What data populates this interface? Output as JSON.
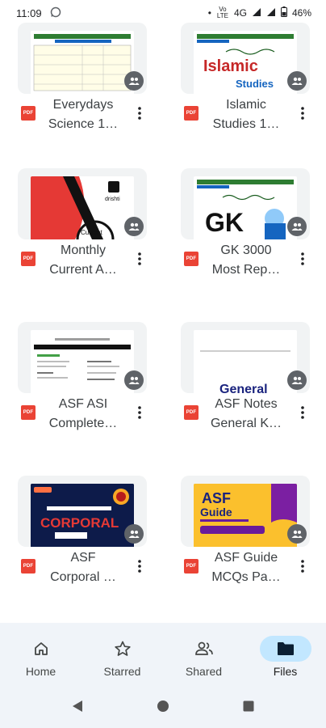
{
  "status_bar": {
    "time": "11:09",
    "network": "4G",
    "volte": "Vo LTE",
    "battery": "46%"
  },
  "files": [
    {
      "name": "Everydays\nScience 1…",
      "thumb_label": "",
      "thumb_theme": "table"
    },
    {
      "name": "Islamic\nStudies 1…",
      "thumb_label": "Islamic\nStudies",
      "thumb_theme": "islamic"
    },
    {
      "name": "Monthly\nCurrent A…",
      "thumb_label": "drishti",
      "thumb_theme": "drishti"
    },
    {
      "name": "GK 3000\nMost Rep…",
      "thumb_label": "GK",
      "thumb_theme": "gk"
    },
    {
      "name": "ASF ASI\nComplete…",
      "thumb_label": "Airport Security Force(ASF)",
      "thumb_theme": "asfasi"
    },
    {
      "name": "ASF Notes\nGeneral K…",
      "thumb_label": "General",
      "thumb_theme": "general"
    },
    {
      "name": "ASF\nCorporal …",
      "thumb_label": "CORPORAL",
      "thumb_theme": "corporal"
    },
    {
      "name": "ASF Guide\nMCQs Pa…",
      "thumb_label": "ASF\nGuide",
      "thumb_theme": "guide"
    }
  ],
  "file_type_badge": "PDF",
  "bottom_nav": [
    {
      "label": "Home",
      "icon": "home-icon",
      "active": false
    },
    {
      "label": "Starred",
      "icon": "star-icon",
      "active": false
    },
    {
      "label": "Shared",
      "icon": "shared-icon",
      "active": false
    },
    {
      "label": "Files",
      "icon": "folder-icon",
      "active": true
    }
  ],
  "colors": {
    "pdf_red": "#ea4335",
    "nav_background": "#f0f4f9",
    "active_pill": "#c2e7ff",
    "thumb_background": "#f1f3f4"
  }
}
